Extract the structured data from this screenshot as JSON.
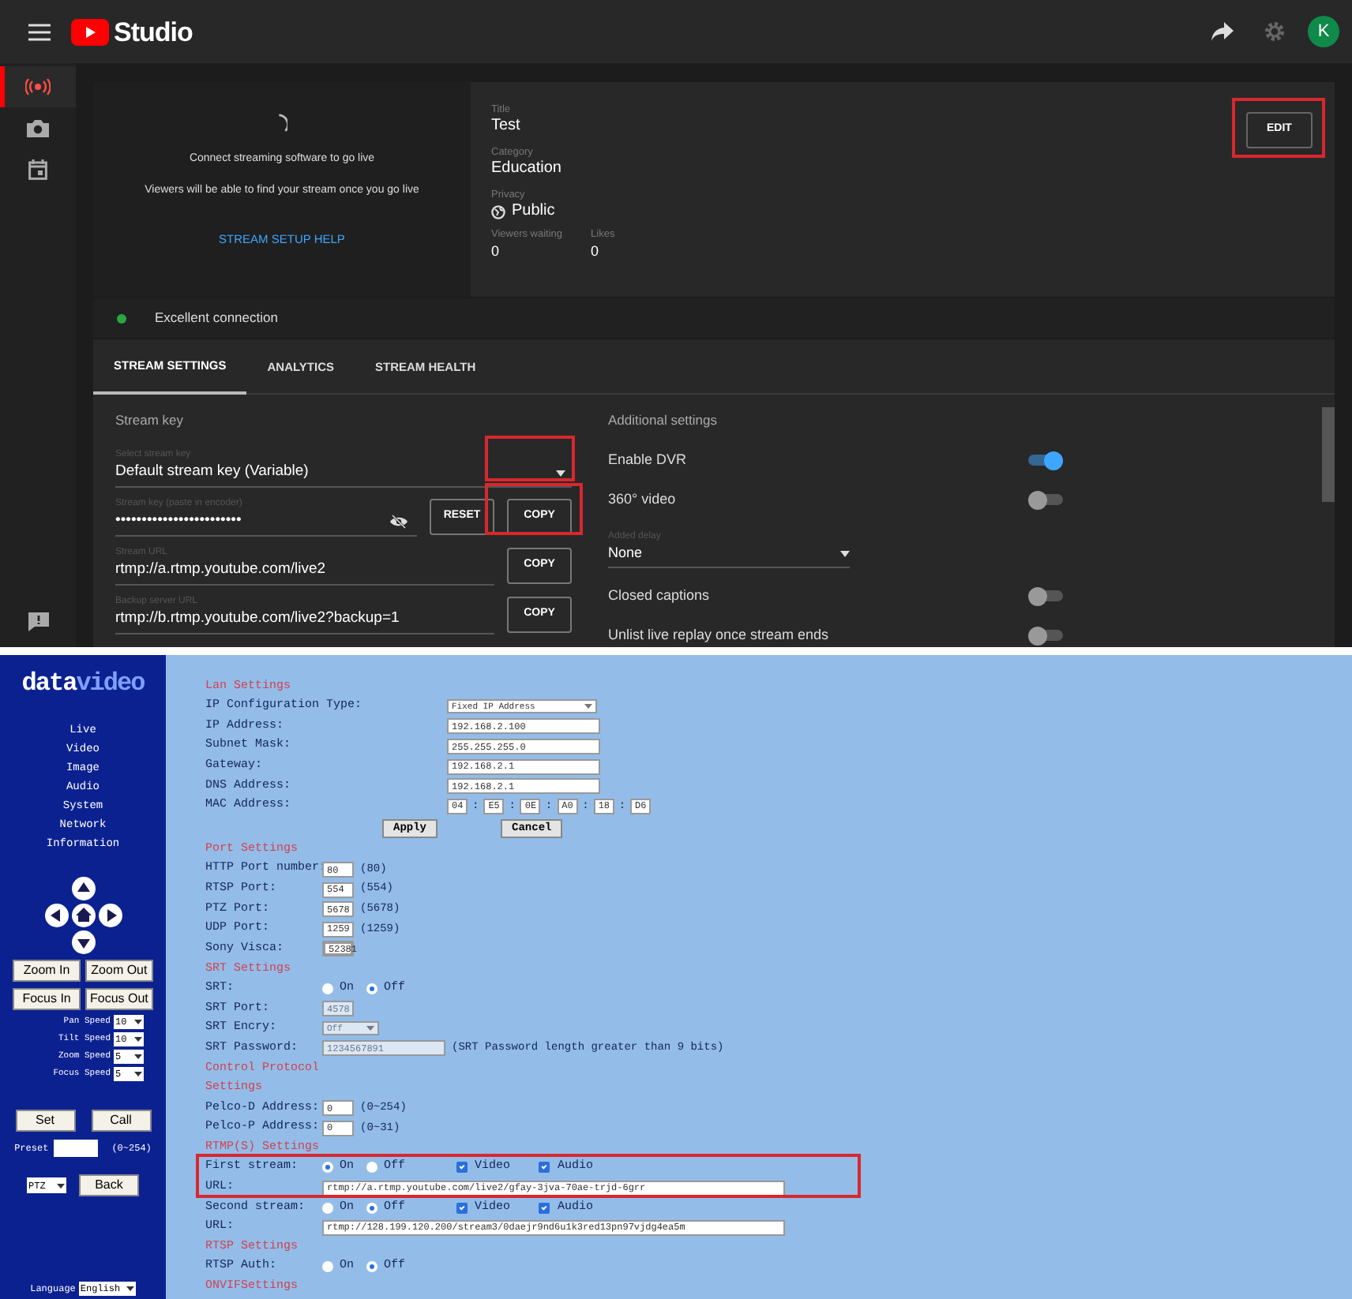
{
  "studio": {
    "header": {
      "title": "Studio",
      "avatar": "K"
    },
    "rail": [
      {
        "kind": "live",
        "selected": true
      },
      {
        "kind": "camera",
        "selected": false
      },
      {
        "kind": "calendar",
        "selected": false
      }
    ],
    "preview": {
      "message": "Connect streaming software to go live",
      "note": "Viewers will be able to find your stream once you go live",
      "help_link": "STREAM SETUP HELP"
    },
    "info": {
      "fields": [
        {
          "label": "Title",
          "value": "Test"
        },
        {
          "label": "Category",
          "value": "Education"
        },
        {
          "label": "Privacy",
          "value": "Public"
        }
      ],
      "stats": [
        {
          "label": "Viewers waiting",
          "value": "0"
        },
        {
          "label": "Likes",
          "value": "0"
        }
      ],
      "edit_button": "EDIT"
    },
    "connection": {
      "text": "Excellent connection",
      "color": "#2ba640"
    },
    "tabs": [
      {
        "label": "STREAM SETTINGS",
        "selected": true
      },
      {
        "label": "ANALYTICS",
        "selected": false
      },
      {
        "label": "STREAM HEALTH",
        "selected": false
      }
    ],
    "stream_key": {
      "heading": "Stream key",
      "fields": [
        {
          "kind": "select",
          "label": "Select stream key",
          "value": "Default stream key (Variable)"
        },
        {
          "kind": "secret",
          "label": "Stream key (paste in encoder)",
          "value": "••••••••••••••••••••••••",
          "buttons": [
            "RESET",
            "COPY"
          ]
        },
        {
          "kind": "url",
          "label": "Stream URL",
          "value": "rtmp://a.rtmp.youtube.com/live2",
          "buttons": [
            "COPY"
          ]
        },
        {
          "kind": "url",
          "label": "Backup server URL",
          "value": "rtmp://b.rtmp.youtube.com/live2?backup=1",
          "buttons": [
            "COPY"
          ]
        }
      ]
    },
    "additional": {
      "heading": "Additional settings",
      "items": [
        {
          "kind": "toggle",
          "label": "Enable DVR",
          "on": true
        },
        {
          "kind": "toggle",
          "label": "360° video",
          "on": false
        },
        {
          "kind": "select",
          "label": "Added delay",
          "value": "None"
        },
        {
          "kind": "toggle",
          "label": "Closed captions",
          "on": false
        },
        {
          "kind": "toggle",
          "label": "Unlist live replay once stream ends",
          "on": false
        }
      ]
    }
  },
  "camera": {
    "sidebar": {
      "logo": [
        "data",
        "video"
      ],
      "menu": [
        "Live",
        "Video",
        "Image",
        "Audio",
        "System",
        "Network",
        "Information"
      ],
      "lens_buttons": [
        "Zoom In",
        "Zoom Out",
        "Focus In",
        "Focus Out"
      ],
      "speeds": [
        {
          "label": "Pan Speed",
          "value": "10"
        },
        {
          "label": "Tilt Speed",
          "value": "10"
        },
        {
          "label": "Zoom Speed",
          "value": "5"
        },
        {
          "label": "Focus Speed",
          "value": "5"
        }
      ],
      "preset_buttons": [
        "Set",
        "Call"
      ],
      "preset": {
        "label": "Preset",
        "hint": "(0~254)"
      },
      "mode": "PTZ",
      "back": "Back",
      "language": {
        "label": "Language",
        "value": "English"
      }
    },
    "sections": [
      {
        "title": "Lan Settings",
        "rows": [
          {
            "kind": "lan-select",
            "label": "IP Configuration Type:",
            "value": "Fixed IP Address"
          },
          {
            "kind": "lan-text",
            "label": "IP Address:",
            "value": "192.168.2.100"
          },
          {
            "kind": "lan-text",
            "label": "Subnet Mask:",
            "value": "255.255.255.0"
          },
          {
            "kind": "lan-text",
            "label": "Gateway:",
            "value": "192.168.2.1"
          },
          {
            "kind": "lan-text",
            "label": "DNS Address:",
            "value": "192.168.2.1"
          },
          {
            "kind": "mac",
            "label": "MAC Address:",
            "parts": [
              "04",
              "E5",
              "0E",
              "A0",
              "18",
              "D6"
            ],
            "separator": ":"
          }
        ],
        "buttons": [
          "Apply",
          "Cancel"
        ]
      },
      {
        "title": "Port Settings",
        "rows": [
          {
            "kind": "port",
            "label": "HTTP Port number:",
            "value": "80",
            "hint": "(80)"
          },
          {
            "kind": "port",
            "label": "RTSP Port:",
            "value": "554",
            "hint": "(554)"
          },
          {
            "kind": "port",
            "label": "PTZ Port:",
            "value": "5678",
            "hint": "(5678)"
          },
          {
            "kind": "port",
            "label": "UDP Port:",
            "value": "1259",
            "hint": "(1259)"
          },
          {
            "kind": "readout",
            "label": "Sony Visca:",
            "value": "52381"
          }
        ]
      },
      {
        "title": "SRT Settings",
        "rows": [
          {
            "kind": "radio",
            "label": "SRT:",
            "options": [
              {
                "label": "On",
                "selected": false
              },
              {
                "label": "Off",
                "selected": true
              }
            ]
          },
          {
            "kind": "port",
            "label": "SRT Port:",
            "value": "4578",
            "disabled": true
          },
          {
            "kind": "small-select",
            "label": "SRT Encry:",
            "value": "Off",
            "disabled": true
          },
          {
            "kind": "password",
            "label": "SRT Password:",
            "value": "1234567891",
            "hint": "(SRT Password length greater than 9 bits)",
            "disabled": true
          }
        ]
      },
      {
        "title": "Control Protocol Settings",
        "rows": [
          {
            "kind": "port",
            "label": "Pelco-D Address:",
            "value": "0",
            "hint": "(0~254)"
          },
          {
            "kind": "port",
            "label": "Pelco-P Address:",
            "value": "0",
            "hint": "(0~31)"
          }
        ]
      },
      {
        "title": "RTMP(S) Settings",
        "rows": [
          {
            "kind": "stream",
            "label": "First stream:",
            "options": [
              {
                "label": "On",
                "selected": true
              },
              {
                "label": "Off",
                "selected": false
              }
            ],
            "checks": [
              {
                "label": "Video",
                "checked": true
              },
              {
                "label": "Audio",
                "checked": true
              }
            ]
          },
          {
            "kind": "url",
            "label": "URL:",
            "value": "rtmp://a.rtmp.youtube.com/live2/gfay-3jva-70ae-trjd-6grr"
          },
          {
            "kind": "stream",
            "label": "Second stream:",
            "options": [
              {
                "label": "On",
                "selected": false
              },
              {
                "label": "Off",
                "selected": true
              }
            ],
            "checks": [
              {
                "label": "Video",
                "checked": true
              },
              {
                "label": "Audio",
                "checked": true
              }
            ]
          },
          {
            "kind": "url",
            "label": "URL:",
            "value": "rtmp://128.199.120.200/stream3/0daejr9nd6u1k3red13pn97vjdg4ea5m"
          }
        ]
      },
      {
        "title": "RTSP Settings",
        "rows": [
          {
            "kind": "radio",
            "label": "RTSP Auth:",
            "options": [
              {
                "label": "On",
                "selected": false
              },
              {
                "label": "Off",
                "selected": true
              }
            ]
          }
        ]
      },
      {
        "title": "ONVIFSettings"
      }
    ]
  }
}
